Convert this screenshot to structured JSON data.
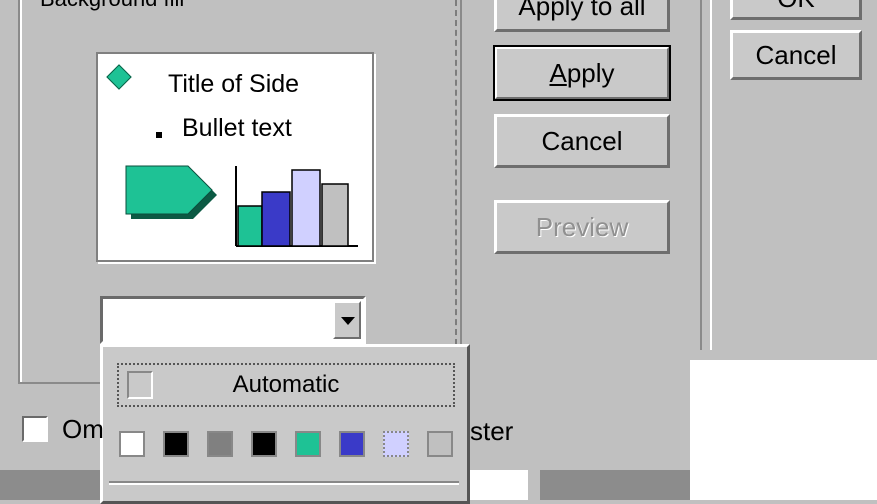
{
  "dialog": {
    "group_title": "Background fill",
    "buttons": {
      "apply_to_all": "Apply to all",
      "apply": "Apply",
      "cancel": "Cancel",
      "preview": "Preview",
      "ok": "OK",
      "cancel_right": "Cancel"
    },
    "preview": {
      "title": "Title of Side",
      "bullet": "Bullet text"
    },
    "combo": {
      "value": ""
    },
    "dropdown": {
      "automatic_label": "Automatic",
      "swatches": [
        "#ffffff",
        "#000000",
        "#808080",
        "#000000",
        "#1ec295",
        "#3a3ac8",
        "#d0d0ff",
        "#c0c0c0"
      ]
    },
    "omit_label": "Om",
    "master_label": "ster"
  }
}
